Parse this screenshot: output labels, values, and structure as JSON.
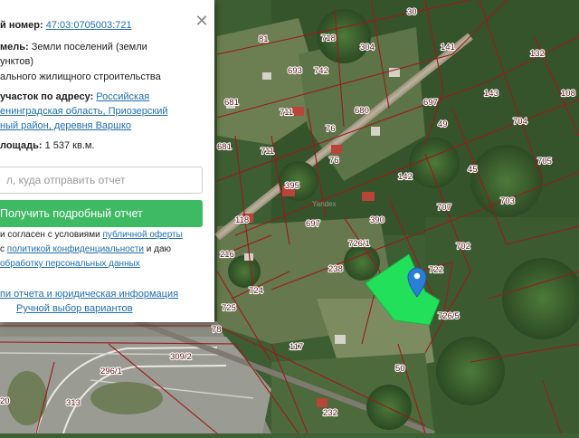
{
  "panel": {
    "cadastral_number_label": "й номер:",
    "cadastral_number_value": "47:03:0705003:721",
    "land_category_label": "мель:",
    "land_category_line1": "Земли поселений (земли",
    "land_category_line2": "унктов)",
    "permitted_use": "ального жилищного строительства",
    "address_label": "участок по адресу:",
    "address_line1": "Российская",
    "address_line2": "енинградская область, Приозерский",
    "address_line3": "ный район, деревня Варшко",
    "area_label": "лощадь:",
    "area_value": "1 537 кв.м.",
    "email_placeholder": "л, куда отправить отчет",
    "report_button": "Получить подробный отчет",
    "consent_line1_a": "и согласен с условиями ",
    "consent_line1_link": "публичной оферты",
    "consent_line2_a": "с ",
    "consent_line2_link": "политикой конфиденциальности",
    "consent_line2_b": " и даю",
    "consent_line3_link": "обработку персональных данных",
    "report_info_link": "пи отчета и юридическая информация",
    "manual_select_link": "Ручной выбор вариантов"
  },
  "map": {
    "selected_parcel_color": "#22e05a",
    "boundary_color": "#9b1a1a",
    "marker_color": "#2a7fd4",
    "watermark": "Yandex",
    "parcel_labels": [
      "30",
      "81",
      "718",
      "304",
      "141",
      "132",
      "693",
      "742",
      "108",
      "681",
      "711",
      "680",
      "143",
      "76",
      "697",
      "704",
      "49",
      "681",
      "711",
      "76",
      "705",
      "45",
      "395",
      "142",
      "707",
      "703",
      "118",
      "697",
      "390",
      "702",
      "216",
      "726/1",
      "238",
      "722",
      "724",
      "726/5",
      "725",
      "78",
      "117",
      "309/2",
      "296/1",
      "313",
      "20",
      "50",
      "232"
    ]
  }
}
